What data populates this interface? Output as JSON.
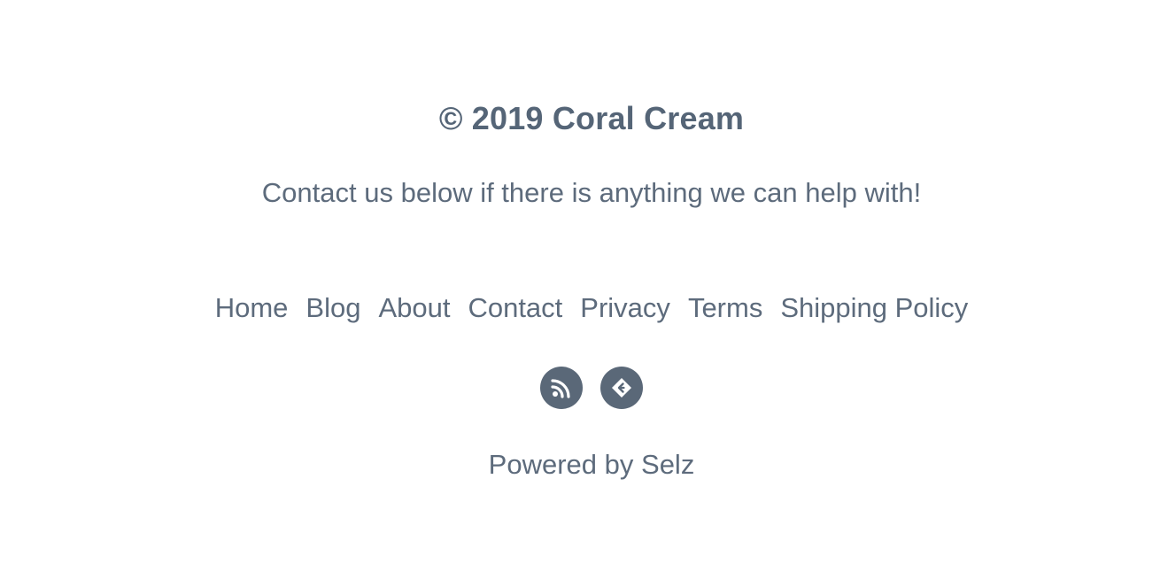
{
  "footer": {
    "copyright": "© 2019 Coral Cream",
    "tagline": "Contact us below if there is anything we can help with!",
    "nav": [
      {
        "label": "Home"
      },
      {
        "label": "Blog"
      },
      {
        "label": "About"
      },
      {
        "label": "Contact"
      },
      {
        "label": "Privacy"
      },
      {
        "label": "Terms"
      },
      {
        "label": "Shipping Policy"
      }
    ],
    "social": [
      {
        "icon": "rss-icon"
      },
      {
        "icon": "selz-icon"
      }
    ],
    "powered_prefix": "Powered by",
    "powered_brand": "Selz",
    "colors": {
      "text": "#5d6b7c",
      "icon_bg": "#5a6878",
      "background": "#ffffff"
    }
  }
}
